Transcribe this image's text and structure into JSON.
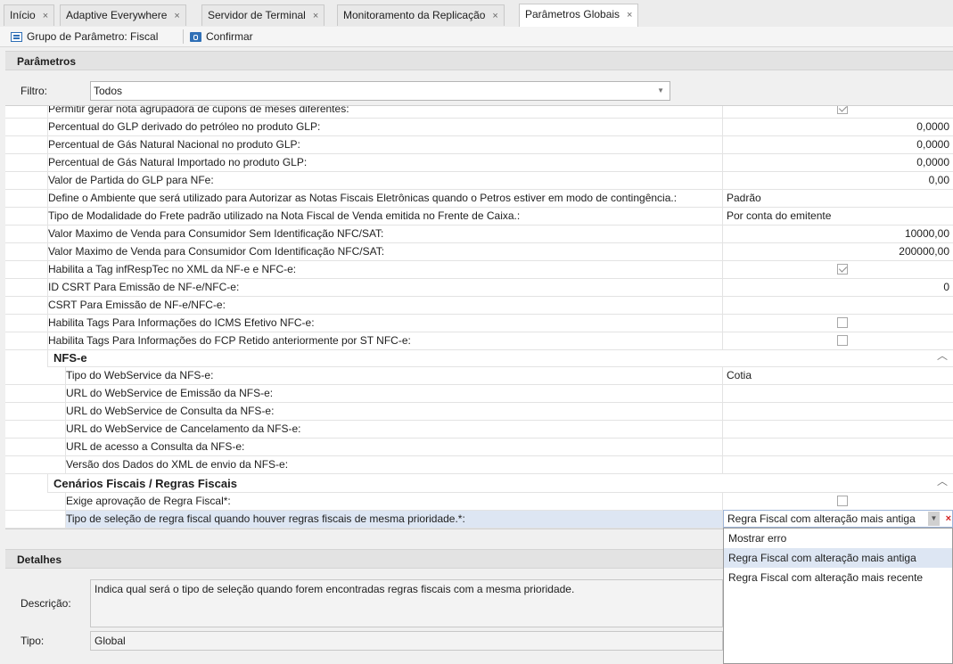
{
  "tabs": [
    {
      "label": "Início"
    },
    {
      "label": "Adaptive Everywhere"
    },
    {
      "label": "Servidor de Terminal"
    },
    {
      "label": "Monitoramento da Replicação"
    },
    {
      "label": "Parâmetros Globais"
    }
  ],
  "tab_close_glyph": "×",
  "toolbar": {
    "group_label": "Grupo de Parâmetro: Fiscal",
    "confirm_label": "Confirmar"
  },
  "params_panel": {
    "title": "Parâmetros",
    "filter_label": "Filtro:",
    "filter_value": "Todos"
  },
  "rows": [
    {
      "label": "Permitir gerar nota agrupadora de cupons de meses diferentes:",
      "type": "check",
      "checked": true
    },
    {
      "label": "Percentual do GLP derivado do petróleo no produto GLP:",
      "type": "num",
      "value": "0,0000"
    },
    {
      "label": "Percentual de Gás Natural Nacional no produto GLP:",
      "type": "num",
      "value": "0,0000"
    },
    {
      "label": "Percentual de Gás Natural Importado no produto GLP:",
      "type": "num",
      "value": "0,0000"
    },
    {
      "label": "Valor de Partida do GLP para NFe:",
      "type": "num",
      "value": "0,00"
    },
    {
      "label": "Define o Ambiente que será utilizado para Autorizar as Notas Fiscais Eletrônicas quando o Petros estiver em modo de contingência.:",
      "type": "text",
      "value": "Padrão"
    },
    {
      "label": "Tipo de Modalidade do Frete padrão utilizado na Nota Fiscal de Venda emitida no Frente de Caixa.:",
      "type": "text",
      "value": "Por conta do emitente"
    },
    {
      "label": "Valor Maximo de Venda para Consumidor Sem Identificação NFC/SAT:",
      "type": "num",
      "value": "10000,00"
    },
    {
      "label": "Valor Maximo de Venda para Consumidor Com Identificação NFC/SAT:",
      "type": "num",
      "value": "200000,00"
    },
    {
      "label": "Habilita a Tag infRespTec no XML da NF-e e NFC-e:",
      "type": "check",
      "checked": true
    },
    {
      "label": "ID CSRT Para Emissão de NF-e/NFC-e:",
      "type": "num",
      "value": "0"
    },
    {
      "label": "CSRT Para Emissão de NF-e/NFC-e:",
      "type": "text",
      "value": ""
    },
    {
      "label": "Habilita Tags Para Informações do ICMS Efetivo NFC-e:",
      "type": "check",
      "checked": false
    },
    {
      "label": "Habilita Tags Para Informações do FCP Retido anteriormente por ST NFC-e:",
      "type": "check",
      "checked": false
    }
  ],
  "nfse_group": {
    "title": "NFS-e",
    "rows": [
      {
        "label": "Tipo do WebService da NFS-e:",
        "value": "Cotia"
      },
      {
        "label": "URL do WebService de Emissão da NFS-e:",
        "value": ""
      },
      {
        "label": "URL do WebService de Consulta da NFS-e:",
        "value": ""
      },
      {
        "label": "URL do WebService de Cancelamento da NFS-e:",
        "value": ""
      },
      {
        "label": "URL de acesso a Consulta da NFS-e:",
        "value": ""
      },
      {
        "label": "Versão dos Dados do XML de envio da NFS-e:",
        "value": ""
      }
    ]
  },
  "fiscal_group": {
    "title": "Cenários Fiscais / Regras Fiscais",
    "row1_label": "Exige aprovação de Regra Fiscal*:",
    "row1_checked": false,
    "row2_label": "Tipo de seleção de regra fiscal quando houver regras fiscais de mesma prioridade.*:",
    "row2_value": "Regra Fiscal com alteração mais antiga"
  },
  "dropdown_options": [
    {
      "label": "Mostrar erro"
    },
    {
      "label": "Regra Fiscal com alteração mais antiga"
    },
    {
      "label": "Regra Fiscal com alteração mais recente"
    }
  ],
  "dropdown_selected_index": 1,
  "details_panel": {
    "title": "Detalhes",
    "desc_label": "Descrição:",
    "desc_text": "Indica qual será o tipo de seleção quando forem encontradas regras fiscais com a mesma prioridade.",
    "tipo_label": "Tipo:",
    "tipo_value": "Global"
  },
  "colors": {
    "accent": "#2f6fb6",
    "selection": "#dde6f3",
    "clear": "#d42020"
  }
}
